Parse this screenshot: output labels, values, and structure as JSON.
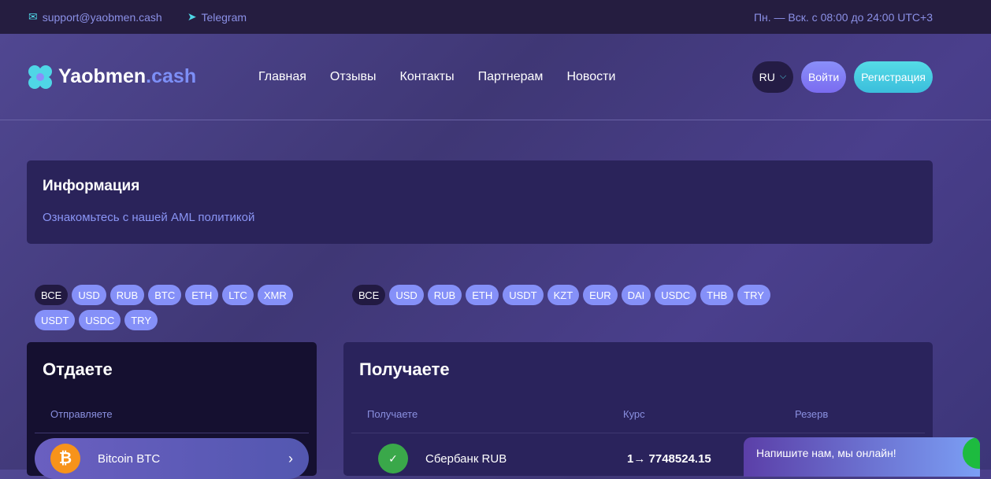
{
  "topbar": {
    "email": "support@yaobmen.cash",
    "telegram": "Telegram",
    "hours": "Пн. — Вск. с 08:00 до 24:00 UTC+3"
  },
  "header": {
    "logo_main": "Yaobmen",
    "logo_suffix": ".cash",
    "nav": [
      "Главная",
      "Отзывы",
      "Контакты",
      "Партнерам",
      "Новости"
    ],
    "lang": "RU",
    "login": "Войти",
    "register": "Регистрация"
  },
  "info": {
    "title": "Информация",
    "text": "Ознакомьтесь с нашей AML политикой"
  },
  "give_filters": [
    "ВСЕ",
    "USD",
    "RUB",
    "BTC",
    "ETH",
    "LTC",
    "XMR",
    "USDT",
    "USDC",
    "TRY"
  ],
  "get_filters": [
    "ВСЕ",
    "USD",
    "RUB",
    "ETH",
    "USDT",
    "KZT",
    "EUR",
    "DAI",
    "USDC",
    "THB",
    "TRY"
  ],
  "give": {
    "title": "Отдаете",
    "col": "Отправляете",
    "row": {
      "name": "Bitcoin BTC",
      "icon": "bitcoin-icon"
    }
  },
  "get": {
    "title": "Получаете",
    "cols": [
      "Получаете",
      "Курс",
      "Резерв"
    ],
    "row": {
      "name": "Сбербанк RUB",
      "rate": "1→ 7748524.15",
      "icon": "sberbank-icon"
    }
  },
  "chat": {
    "text": "Напишите нам, мы онлайн!"
  }
}
